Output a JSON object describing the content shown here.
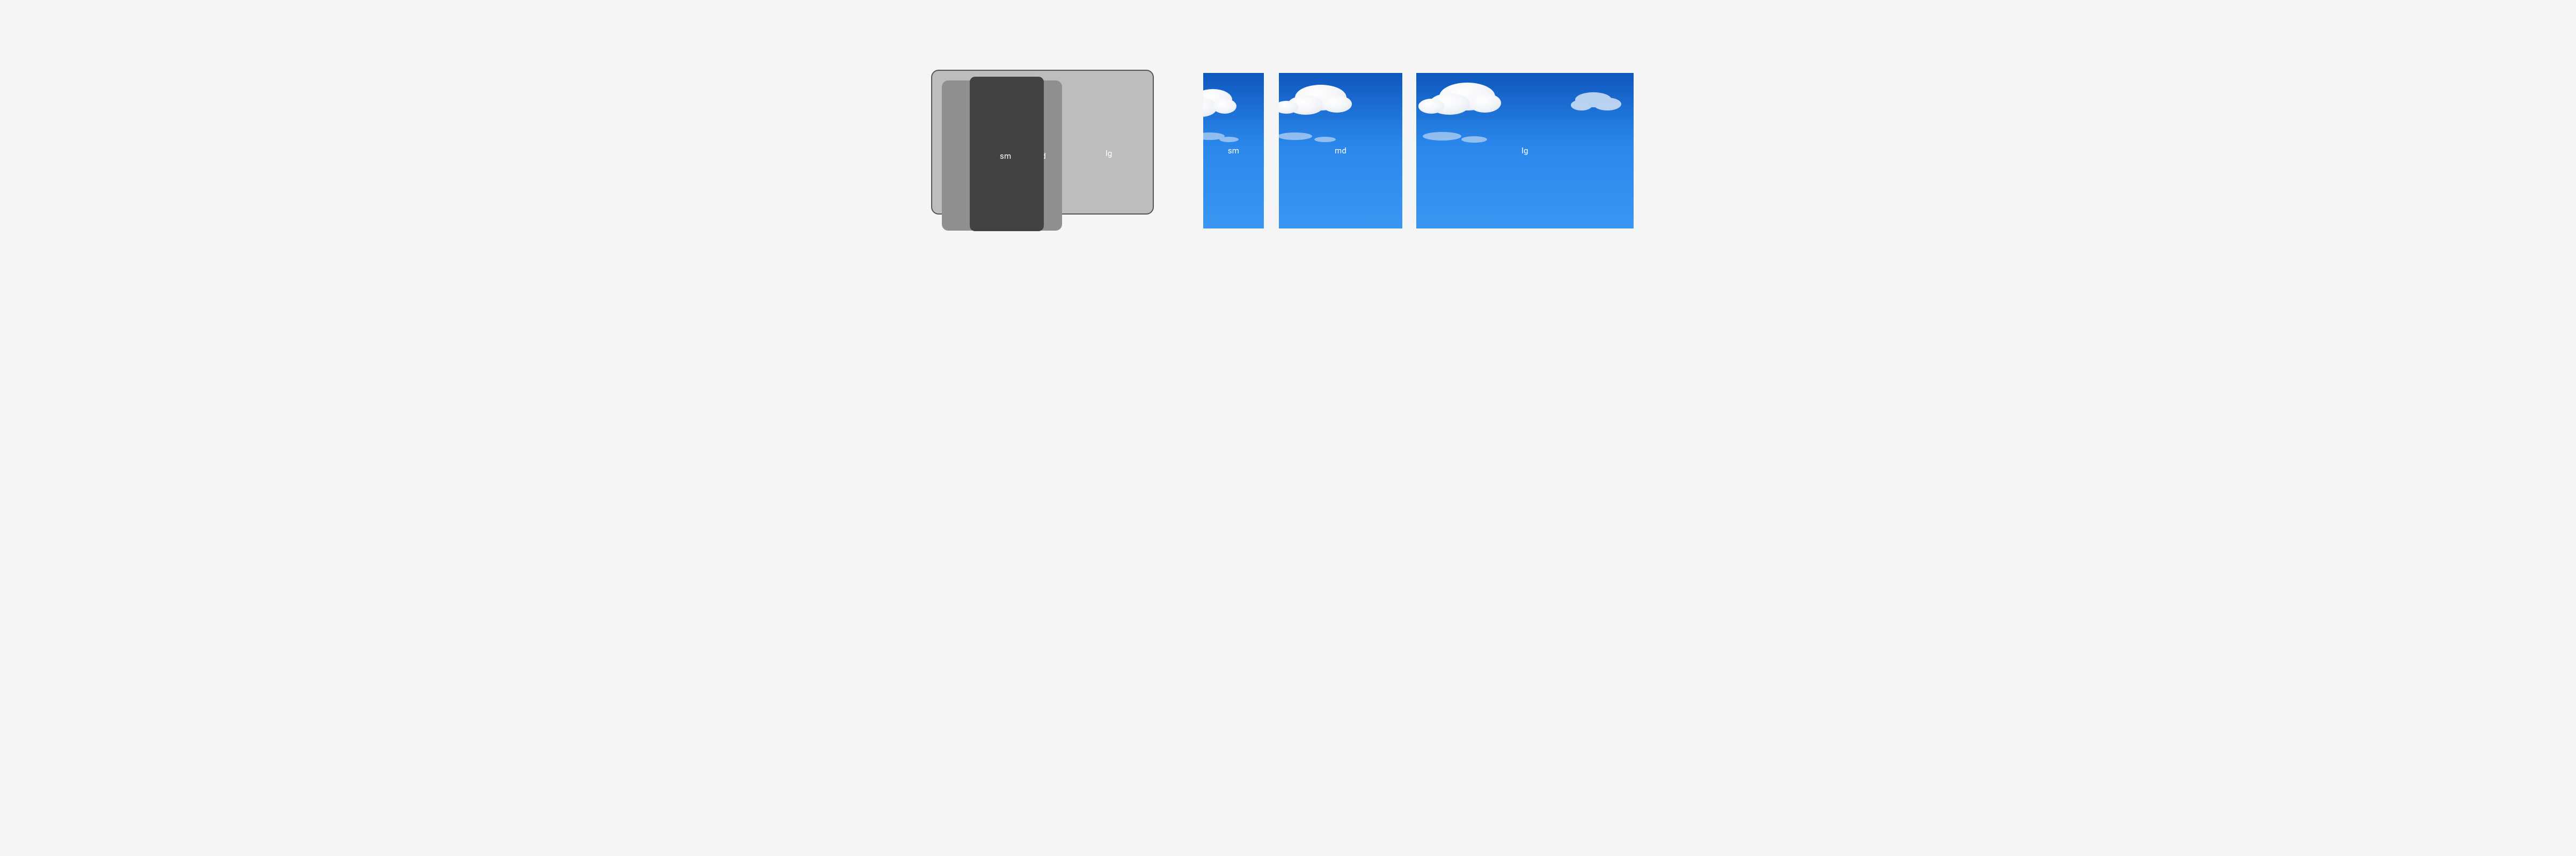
{
  "stacked": {
    "lg": {
      "label": "lg"
    },
    "md": {
      "label": "md"
    },
    "sm": {
      "label": "sm"
    }
  },
  "sky": {
    "sm": {
      "label": "sm"
    },
    "md": {
      "label": "md"
    },
    "lg": {
      "label": "lg"
    }
  }
}
